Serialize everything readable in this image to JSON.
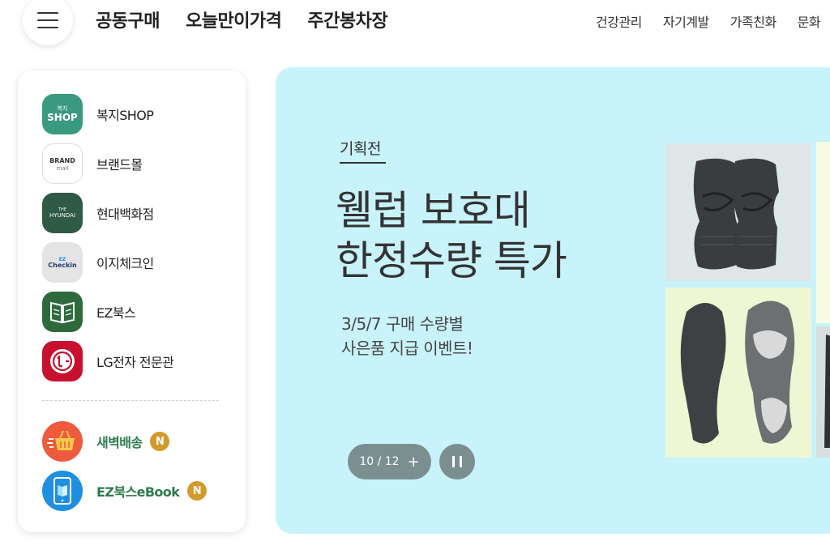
{
  "nav": {
    "main": [
      "공동구매",
      "오늘만이가격",
      "주간봉차장"
    ],
    "sub": [
      "건강관리",
      "자기계발",
      "가족친화",
      "문화"
    ]
  },
  "sidebar": {
    "items": [
      {
        "label": "복지SHOP",
        "icon_text_top": "복지",
        "icon_text_bottom": "SHOP"
      },
      {
        "label": "브랜드몰",
        "icon_text_top": "BRAND",
        "icon_text_bottom": "mall"
      },
      {
        "label": "현대백화점",
        "icon_text_top": "THE",
        "icon_text_bottom": "HYUNDAI"
      },
      {
        "label": "이지체크인",
        "icon_text_top": "EZ",
        "icon_text_bottom": "Checkin"
      },
      {
        "label": "EZ북스"
      },
      {
        "label": "LG전자 전문관"
      }
    ],
    "extras": [
      {
        "label": "새벽배송",
        "badge": "N"
      },
      {
        "label": "EZ북스eBook",
        "badge": "N"
      }
    ]
  },
  "banner": {
    "tag": "기획전",
    "title_lines": [
      "웰럽 보호대",
      "한정수량 특가"
    ],
    "desc_lines": [
      "3/5/7 구매 수량별",
      "사은품 지급 이벤트!"
    ],
    "pager": {
      "text": "10 / 12",
      "plus": "+"
    }
  },
  "colors": {
    "banner_bg": "#c9f3fb",
    "shop_icon": "#3a9a7f",
    "hyundai_icon": "#2f5a45",
    "ezbooks_icon": "#2f6a3d",
    "lg_icon": "#c8102e",
    "delivery_icon": "#ef5a3c",
    "ebook_icon": "#1f8fe0",
    "badge": "#d19a2a",
    "pager_bg": "#7b8f91"
  }
}
